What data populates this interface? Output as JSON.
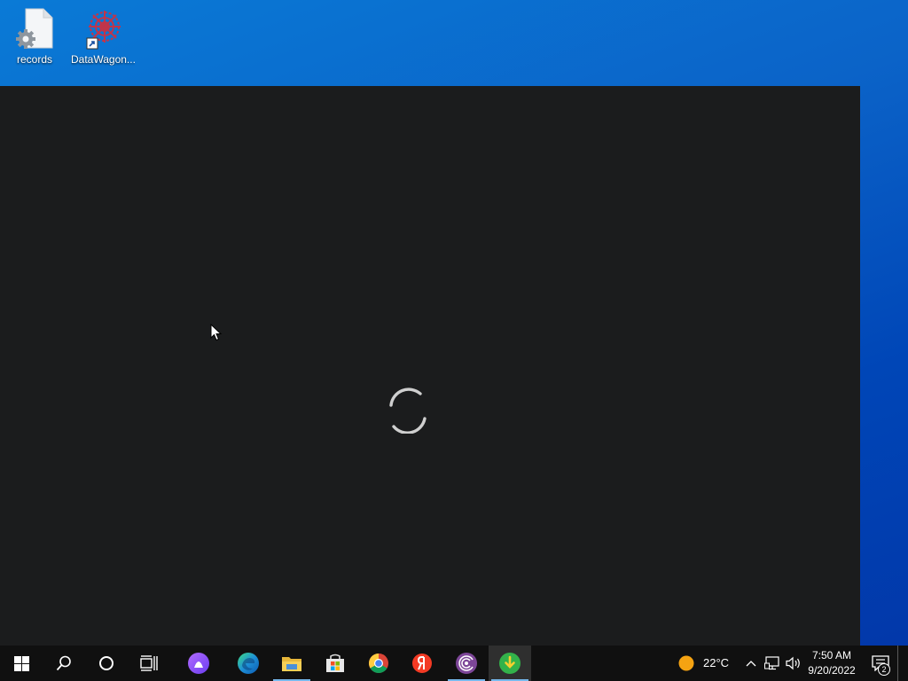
{
  "desktop": {
    "icons": [
      {
        "label": "records",
        "icon": "settings-file-icon"
      },
      {
        "label": "DataWagon...",
        "icon": "datawagon-shortcut-icon"
      }
    ]
  },
  "app_window": {
    "state": "loading",
    "spinner_icon": "loading-spinner-icon",
    "background": "#1b1c1d"
  },
  "taskbar": {
    "pinned": [
      {
        "name": "start-button",
        "icon": "windows-logo-icon"
      },
      {
        "name": "search-button",
        "icon": "search-icon"
      },
      {
        "name": "cortana-button",
        "icon": "cortana-circle-icon"
      },
      {
        "name": "task-view-button",
        "icon": "task-view-icon"
      },
      {
        "name": "alice-app",
        "icon": "alice-icon"
      },
      {
        "name": "edge-app",
        "icon": "edge-icon"
      },
      {
        "name": "file-explorer-app",
        "icon": "folder-icon",
        "running": true
      },
      {
        "name": "store-app",
        "icon": "store-icon"
      },
      {
        "name": "chrome-app",
        "icon": "chrome-icon"
      },
      {
        "name": "yandex-browser-app",
        "icon": "yandex-icon"
      },
      {
        "name": "tor-app",
        "icon": "tor-icon",
        "running": true
      },
      {
        "name": "downloader-app",
        "icon": "download-icon",
        "running": true,
        "active": true
      }
    ],
    "weather": {
      "temperature": "22°C",
      "icon": "sun-icon"
    },
    "clock": {
      "time": "7:50 AM",
      "date": "9/20/2022"
    },
    "notifications": {
      "count": "2"
    }
  },
  "colors": {
    "accent": "#76b9ed",
    "taskbar": "#101010",
    "desktop": "#0a62c9"
  }
}
